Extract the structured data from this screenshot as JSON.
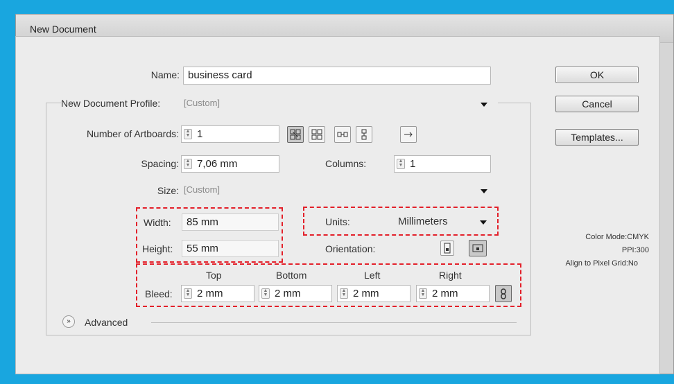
{
  "window": {
    "title": "New Document"
  },
  "form": {
    "name_label": "Name:",
    "name_value": "business card",
    "profile_label": "New Document Profile:",
    "profile_value": "[Custom]",
    "artboards_label": "Number of Artboards:",
    "artboards_value": "1",
    "spacing_label": "Spacing:",
    "spacing_value": "7,06 mm",
    "columns_label": "Columns:",
    "columns_value": "1",
    "size_label": "Size:",
    "size_value": "[Custom]",
    "width_label": "Width:",
    "width_value": "85 mm",
    "height_label": "Height:",
    "height_value": "55 mm",
    "units_label": "Units:",
    "units_value": "Millimeters",
    "orientation_label": "Orientation:",
    "bleed_label": "Bleed:",
    "bleed_headers": {
      "top": "Top",
      "bottom": "Bottom",
      "left": "Left",
      "right": "Right"
    },
    "bleed_values": {
      "top": "2 mm",
      "bottom": "2 mm",
      "left": "2 mm",
      "right": "2 mm"
    },
    "advanced_label": "Advanced"
  },
  "buttons": {
    "ok": "OK",
    "cancel": "Cancel",
    "templates": "Templates..."
  },
  "info": {
    "color_mode": "Color Mode:CMYK",
    "ppi": "PPI:300",
    "pixel_grid": "Align to Pixel Grid:No"
  },
  "colors": {
    "frame": "#19a6df",
    "highlight": "#e3202a"
  }
}
